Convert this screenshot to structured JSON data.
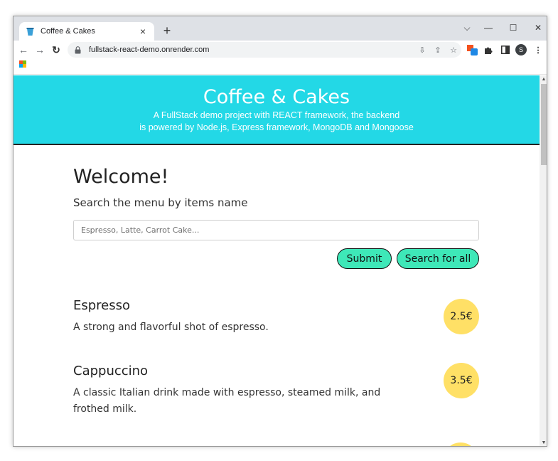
{
  "browser": {
    "tab_title": "Coffee & Cakes",
    "tab_close": "×",
    "new_tab": "+",
    "url": "fullstack-react-demo.onrender.com",
    "profile_initial": "S"
  },
  "header": {
    "title": "Coffee & Cakes",
    "subtitle_line1": "A FullStack demo project with REACT framework, the backend",
    "subtitle_line2": "is powered by Node.js, Express framework, MongoDB and Mongoose",
    "background_color": "#23d8e6"
  },
  "main": {
    "heading": "Welcome!",
    "search_label": "Search the menu by items name",
    "search": {
      "placeholder": "Espresso, Latte, Carrot Cake...",
      "value": ""
    },
    "submit_label": "Submit",
    "search_all_label": "Search for all",
    "button_color": "#3ee8b8",
    "price_badge_color": "#ffe066"
  },
  "menu_items": [
    {
      "name": "Espresso",
      "description": "A strong and flavorful shot of espresso.",
      "price": "2.5€"
    },
    {
      "name": "Cappuccino",
      "description": "A classic Italian drink made with espresso, steamed milk, and frothed milk.",
      "price": "3.5€"
    }
  ],
  "icons": {
    "tab_favicon": "coffee-cup-icon",
    "lock": "lock-icon",
    "omnibox": [
      "install-app-icon",
      "share-icon",
      "bookmark-star-icon"
    ],
    "toolbar": [
      "extension-icon",
      "puzzle-icon",
      "side-panel-icon",
      "profile-avatar",
      "kebab-menu-icon"
    ]
  }
}
